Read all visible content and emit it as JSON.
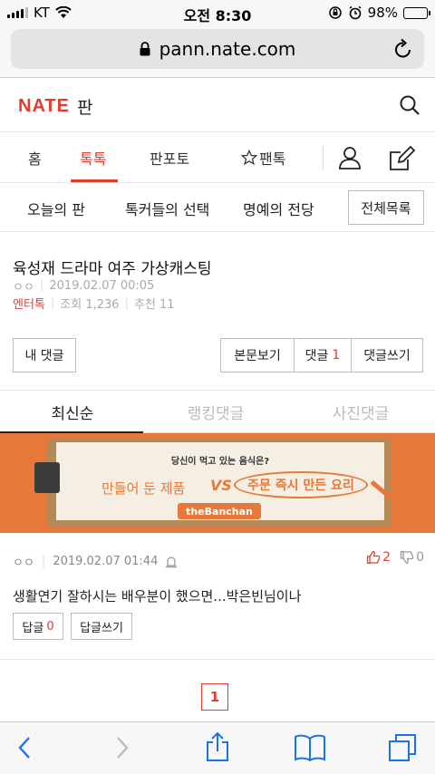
{
  "status_bar": {
    "carrier": "KT",
    "time": "오전 8:30",
    "battery": "98%"
  },
  "browser": {
    "url": "pann.nate.com"
  },
  "site": {
    "logo": "NATE",
    "section": "판"
  },
  "main_nav": {
    "tabs": [
      {
        "label": "홈",
        "active": false
      },
      {
        "label": "톡톡",
        "active": true
      },
      {
        "label": "판포토",
        "active": false
      },
      {
        "label": "팬톡",
        "active": false
      }
    ]
  },
  "sub_nav": {
    "items": [
      "오늘의 판",
      "톡커들의 선택",
      "명예의 전당"
    ],
    "all_button": "전체목록"
  },
  "article": {
    "title": "육성재 드라마 여주 가상캐스팅",
    "author": "ㅇㅇ",
    "date": "2019.02.07 00:05",
    "category": "엔터톡",
    "views": "조회 1,236",
    "recommends": "추천 11"
  },
  "actions": {
    "my_comments": "내 댓글",
    "view_body": "본문보기",
    "comments_label": "댓글",
    "comments_count": "1",
    "write_comment": "댓글쓰기"
  },
  "comment_tabs": [
    {
      "label": "최신순",
      "active": true
    },
    {
      "label": "랭킹댓글",
      "active": false
    },
    {
      "label": "사진댓글",
      "active": false
    }
  ],
  "banner": {
    "question": "당신이 먹고 있는 음식은?",
    "made": "만들어 둔 제품",
    "vs": "VS",
    "fresh": "주문 즉시 만든 요리",
    "brand": "theBanchan"
  },
  "comment": {
    "author": "ㅇㅇ",
    "date": "2019.02.07 01:44",
    "up": "2",
    "down": "0",
    "text": "생활연기 잘하시는 배우분이 했으면...박은빈님이나",
    "reply_label": "답글",
    "reply_count": "0",
    "reply_write": "답글쓰기"
  },
  "pagination": {
    "current": "1"
  },
  "colors": {
    "accent": "#e33d2f",
    "banner": "#e8783a"
  }
}
